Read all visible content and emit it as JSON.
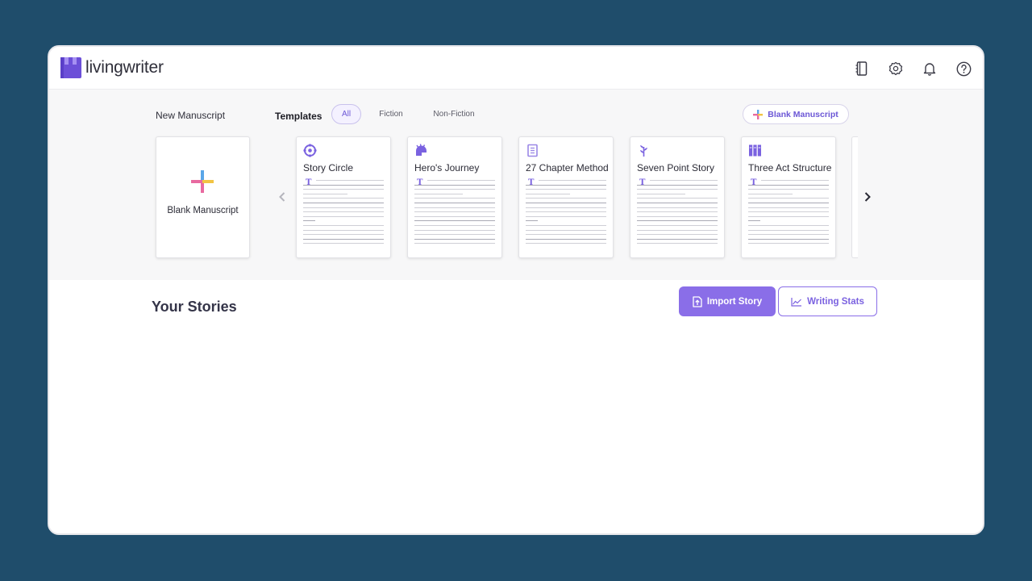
{
  "app": {
    "name": "livingwriter"
  },
  "header": {
    "icons": [
      "notebook-icon",
      "settings-icon",
      "bell-icon",
      "help-icon"
    ]
  },
  "templates_section": {
    "new_manuscript_label": "New Manuscript",
    "templates_label": "Templates",
    "filters": [
      "All",
      "Fiction",
      "Non-Fiction"
    ],
    "active_filter": "All",
    "blank_pill_label": "Blank Manuscript",
    "blank_card_label": "Blank Manuscript",
    "cards": [
      {
        "title": "Story Circle",
        "icon": "story-circle-icon"
      },
      {
        "title": "Hero's Journey",
        "icon": "helmet-icon"
      },
      {
        "title": "27 Chapter Method",
        "icon": "book-icon"
      },
      {
        "title": "Seven Point Story",
        "icon": "plant-icon"
      },
      {
        "title": "Three Act Structure",
        "icon": "columns-icon"
      }
    ]
  },
  "stories": {
    "title": "Your Stories",
    "import_label": "Import Story",
    "stats_label": "Writing Stats"
  },
  "colors": {
    "background": "#1f4d6b",
    "accent": "#8a6ee8",
    "panel": "#f7f7f8"
  }
}
